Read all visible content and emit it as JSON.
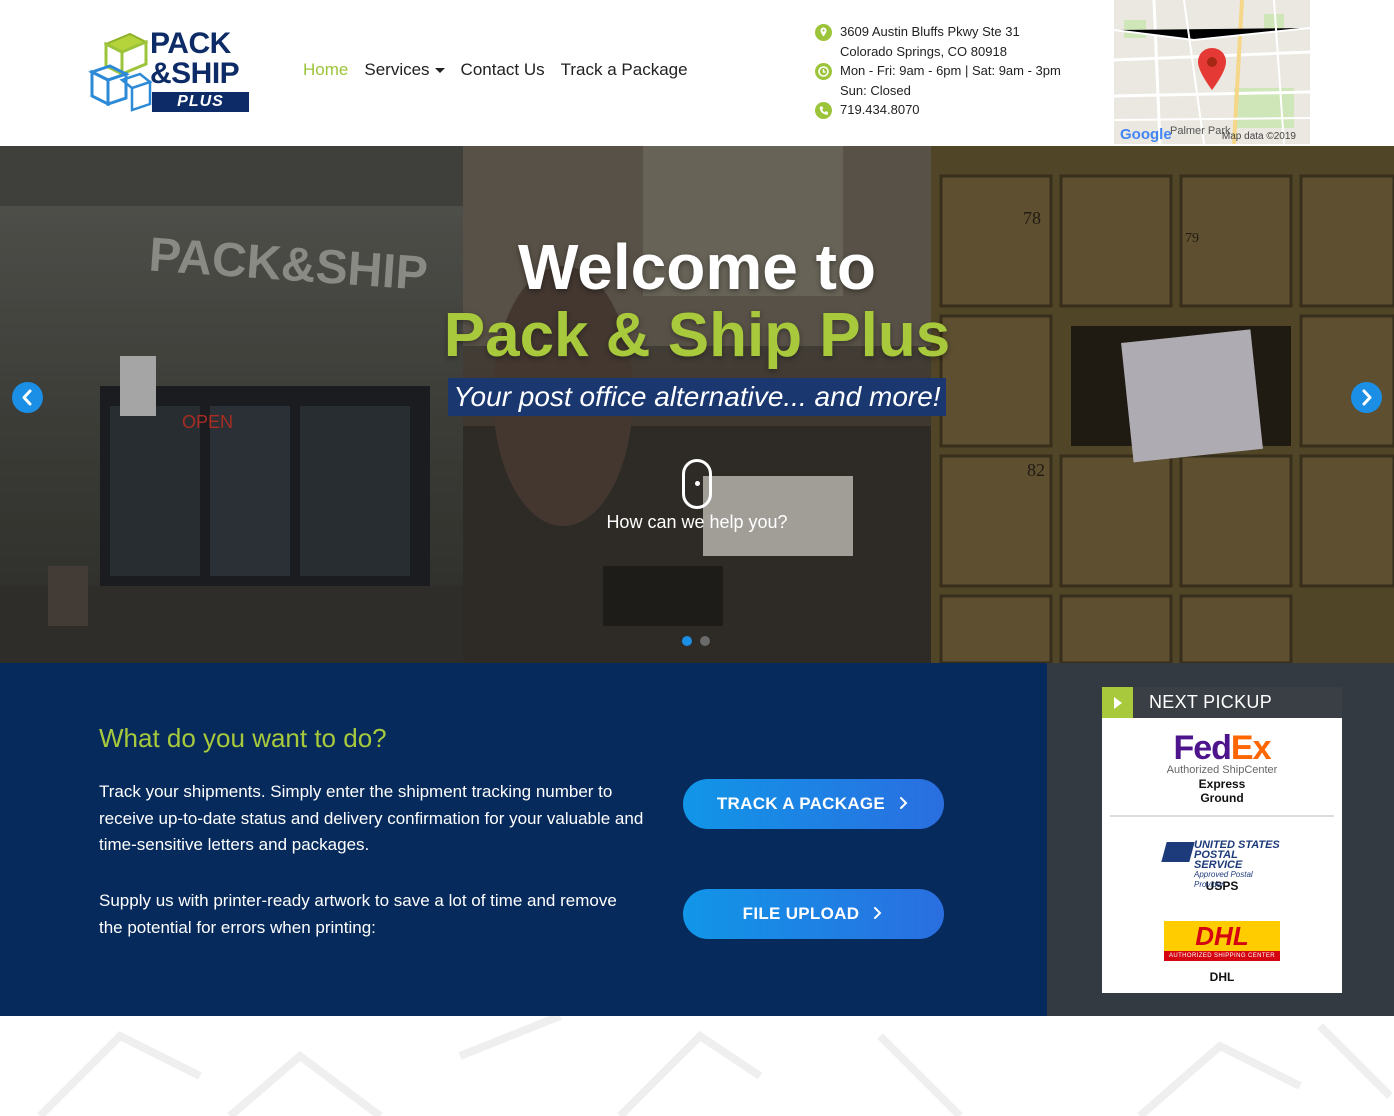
{
  "header": {
    "logo": {
      "line1": "PACK",
      "line2": "&SHIP",
      "line3": "PLUS"
    },
    "nav": [
      {
        "label": "Home",
        "active": true
      },
      {
        "label": "Services",
        "dropdown": true
      },
      {
        "label": "Contact Us"
      },
      {
        "label": "Track a Package"
      }
    ],
    "contact": {
      "address1": "3609 Austin Bluffs Pkwy Ste 31",
      "address2": "Colorado Springs, CO 80918",
      "hours1": "Mon - Fri: 9am - 6pm | Sat: 9am - 3pm",
      "hours2": "Sun: Closed",
      "phone": "719.434.8070"
    },
    "map": {
      "brand": "Google",
      "place": "Palmer Park",
      "credit": "Map data ©2019"
    }
  },
  "hero": {
    "title1": "Welcome to",
    "title2": "Pack & Ship Plus",
    "tagline": "Your post office alternative... and more!",
    "help": "How can we help you?",
    "prev_icon": "chevron-left-icon",
    "next_icon": "chevron-right-icon",
    "slides_total": 2,
    "slide_active": 1
  },
  "actions": {
    "title": "What do you want to do?",
    "p1": "Track your shipments. Simply enter the shipment tracking number to receive up-to-date status and delivery confirmation for your valuable and time-sensitive letters and packages.",
    "p2": "Supply us with printer-ready artwork to save a lot of time and remove the potential for errors when printing:",
    "btn1": "TRACK A PACKAGE",
    "btn2": "FILE UPLOAD"
  },
  "pickup": {
    "title": "NEXT PICKUP",
    "fedex": {
      "logo_a": "Fed",
      "logo_b": "Ex",
      "sub": "Authorized ShipCenter",
      "l1": "Express",
      "l2": "Ground"
    },
    "usps": {
      "logo1": "UNITED STATES",
      "logo2": "POSTAL SERVICE",
      "logo3": "Approved Postal Provider",
      "label": "USPS"
    },
    "dhl": {
      "logo": "DHL",
      "strip": "AUTHORIZED SHIPPING CENTER",
      "label": "DHL"
    }
  },
  "colors": {
    "brand_navy": "#0d2b66",
    "accent_green": "#a8c93c",
    "button_blue": "#1196e8",
    "section_navy": "#062a5b",
    "sidebar_dark": "#343a41"
  }
}
